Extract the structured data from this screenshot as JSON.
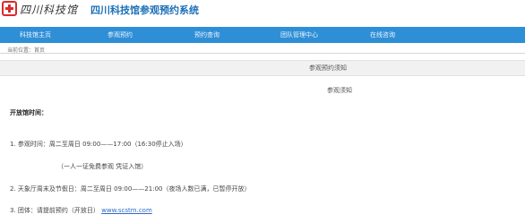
{
  "header": {
    "logo_text": "四川科技馆",
    "site_title": "四川科技馆参观预约系统"
  },
  "nav": {
    "items": [
      "科技馆主页",
      "参观预约",
      "预约查询",
      "团队管理中心",
      "在线咨询"
    ]
  },
  "breadcrumb": "当前位置：首页",
  "content": {
    "title": "参观预约须知",
    "subtitle": "参观须知",
    "opening_label": "开放馆时间：",
    "lines": [
      "1.   参观时间：周二至周日 09:00——17:00（16:30停止入场）",
      "（一人一证免费参观 凭证入馆）",
      "2. 天象厅周末及节假日：周二至周日 09:00——21:00（夜场人数已满，已暂停开放）",
      "3.   团体：请提前预约（开放日）"
    ],
    "link_text": "www.scstm.com"
  },
  "colors": {
    "nav_bg": "#2f8fd6",
    "title_blue": "#1a6fb5",
    "logo_red": "#d92b2b"
  }
}
